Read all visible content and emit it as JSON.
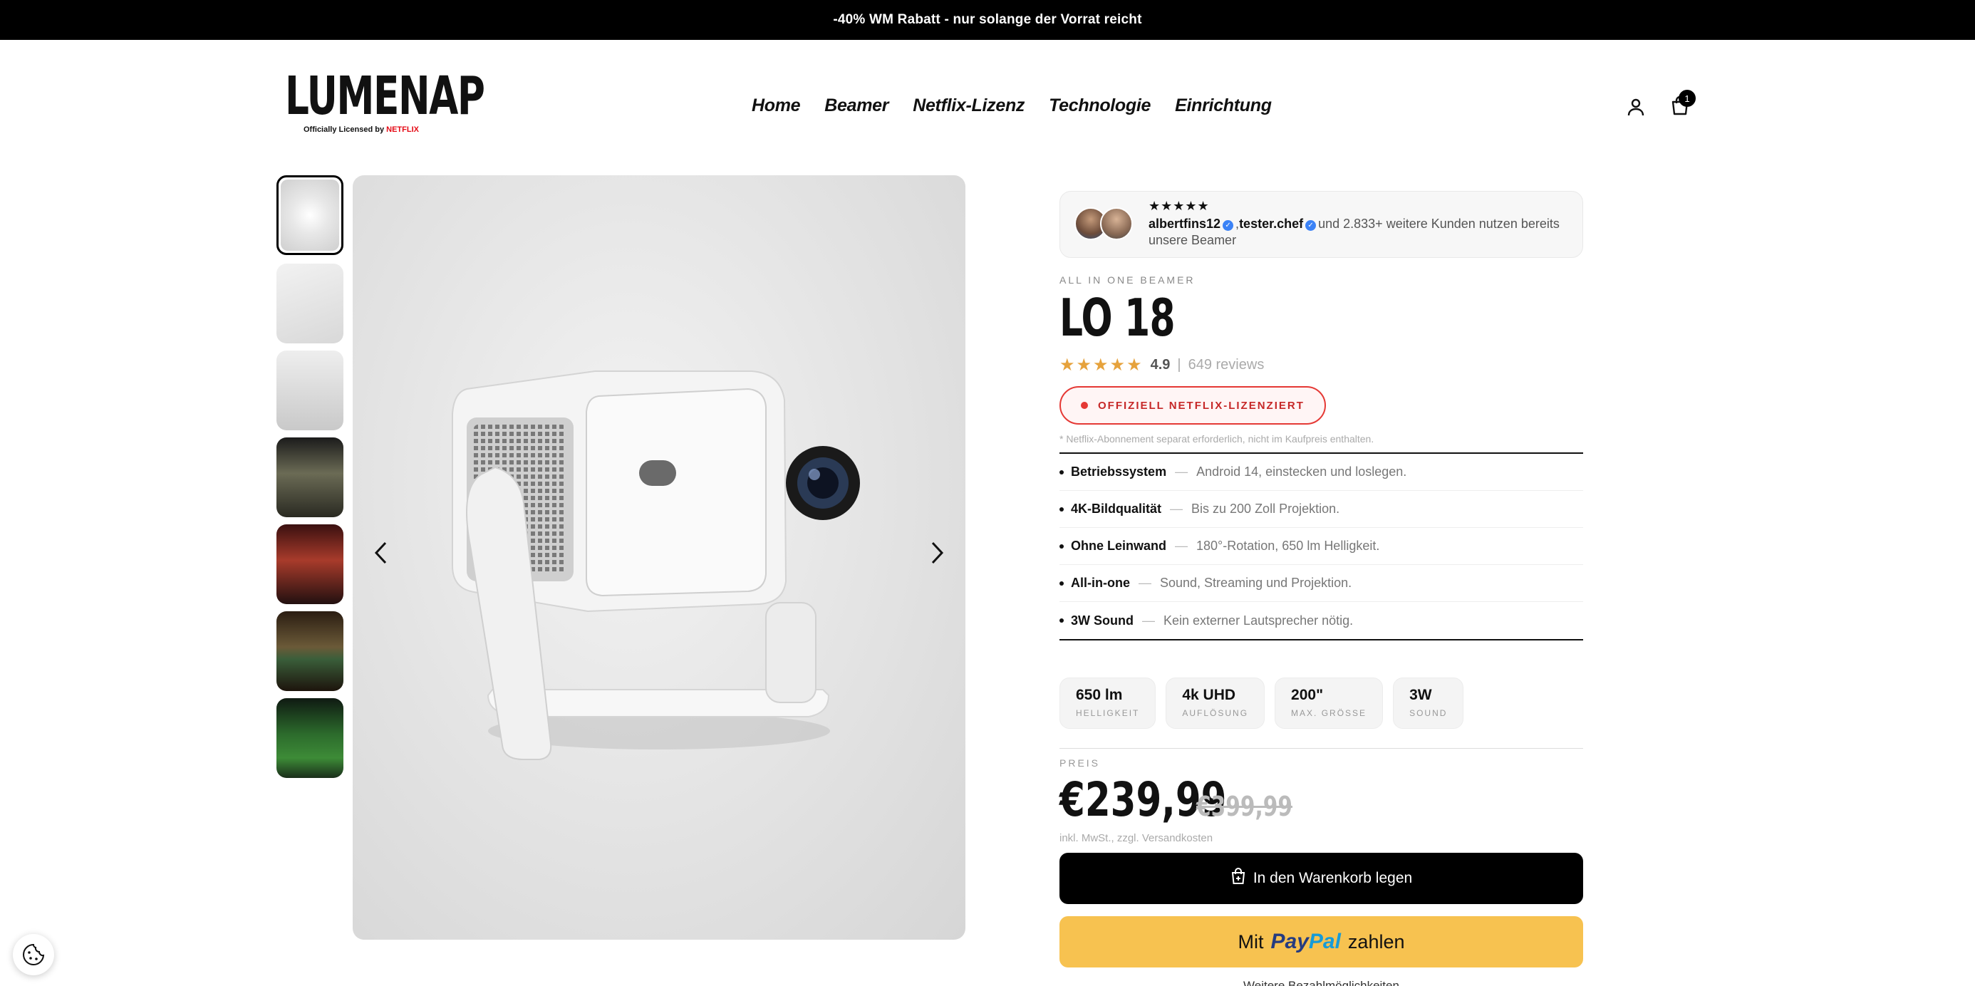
{
  "announcement": "-40% WM Rabatt - nur solange der Vorrat reicht",
  "logo": {
    "word": "LUMENAP",
    "sub": "Officially Licensed by",
    "sub_brand": "NETFLIX"
  },
  "nav": [
    "Home",
    "Beamer",
    "Netflix-Lizenz",
    "Technologie",
    "Einrichtung"
  ],
  "cart_count": "1",
  "social_proof": {
    "stars": "★★★★★",
    "user1": "albertfins12",
    "user2": "tester.chef",
    "text": "und 2.833+ weitere Kunden nutzen bereits unsere Beamer"
  },
  "product": {
    "eyebrow": "ALL IN ONE BEAMER",
    "title": "LO 18",
    "rating_stars": "★★★★★",
    "rating": "4.9",
    "rating_sep": "|",
    "reviews": "649 reviews",
    "badge": "OFFIZIELL NETFLIX-LIZENZIERT",
    "note": "* Netflix-Abonnement separat erforderlich, nicht im Kaufpreis enthalten."
  },
  "features": [
    {
      "name": "Betriebssystem",
      "desc": "Android 14, einstecken und loslegen."
    },
    {
      "name": "4K-Bildqualität",
      "desc": "Bis zu 200 Zoll Projektion."
    },
    {
      "name": "Ohne Leinwand",
      "desc": "180°-Rotation, 650 lm Helligkeit."
    },
    {
      "name": "All-in-one",
      "desc": "Sound, Streaming und Projektion."
    },
    {
      "name": "3W Sound",
      "desc": "Kein externer Lautsprecher nötig."
    }
  ],
  "specs": [
    {
      "value": "650 lm",
      "label": "HELLIGKEIT"
    },
    {
      "value": "4k UHD",
      "label": "AUFLÖSUNG"
    },
    {
      "value": "200\"",
      "label": "MAX. GRÖSSE"
    },
    {
      "value": "3W",
      "label": "SOUND"
    }
  ],
  "pricing": {
    "label": "PREIS",
    "price": "€239,99",
    "old_price": "€399,99",
    "tax": "inkl. MwSt., zzgl. Versandkosten"
  },
  "buttons": {
    "add_to_cart": "In den Warenkorb legen",
    "paypal_prefix": "Mit",
    "paypal_a": "Pay",
    "paypal_b": "Pal",
    "paypal_suffix": "zahlen",
    "more_payment": "Weitere Bezahlmöglichkeiten"
  },
  "colors": {
    "accent_red": "#e53935",
    "paypal_yellow": "#f7c250",
    "star_gold": "#e6a23c"
  },
  "icons": [
    "account-icon",
    "cart-icon",
    "chevron-left-icon",
    "chevron-right-icon",
    "cookie-icon",
    "bag-icon",
    "verified-icon"
  ]
}
